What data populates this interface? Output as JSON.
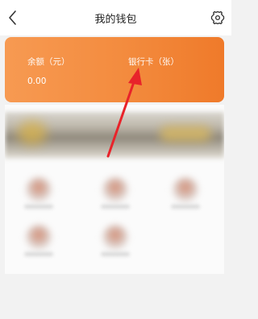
{
  "header": {
    "title": "我的钱包",
    "back_icon": "chevron-left-icon",
    "settings_icon": "gear-icon"
  },
  "wallet": {
    "balance_label": "余额（元）",
    "balance_value": "0.00",
    "bank_card_label": "银行卡（张）"
  },
  "colors": {
    "card_gradient_start": "#f79a52",
    "card_gradient_end": "#ef7a2a",
    "annotation_arrow": "#e8232a",
    "page_background": "#f2f2f2"
  },
  "content": {
    "banner": "blurred promotional banner",
    "services_count_visible": 5
  }
}
